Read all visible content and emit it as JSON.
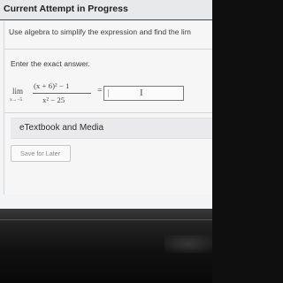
{
  "header": {
    "title": "Current Attempt in Progress"
  },
  "question": {
    "instruction": "Use algebra to simplify the expression and find the lim",
    "prompt": "Enter the exact answer."
  },
  "expression": {
    "lim_word": "lim",
    "lim_sub": "x→−5",
    "numerator": "(x + 6)² − 1",
    "denominator": "x² − 25",
    "equals": "="
  },
  "answer_field": {
    "value": "",
    "cursor_symbol": "I"
  },
  "etextbook": {
    "label": "eTextbook and Media"
  },
  "save": {
    "label": "Save for Later"
  },
  "colors": {
    "page_bg": "#f3f4f6",
    "panel_bg": "#eaeaec",
    "text_primary": "#2e2e2e",
    "text_muted": "#8b8b8b",
    "input_border": "#7b7b7b"
  },
  "icons": {
    "text_cursor": "text-cursor-icon"
  }
}
